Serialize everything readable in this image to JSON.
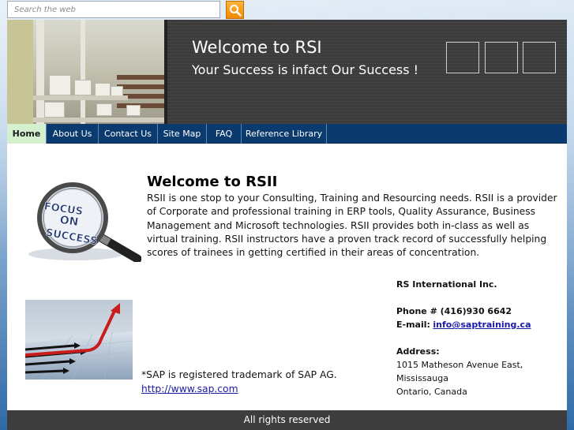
{
  "search": {
    "placeholder": "Search the web"
  },
  "header": {
    "title": "Welcome to RSI",
    "tagline": "Your Success is infact Our Success !"
  },
  "nav": {
    "items": [
      {
        "label": "Home",
        "active": true
      },
      {
        "label": "About Us"
      },
      {
        "label": "Contact Us"
      },
      {
        "label": "Site Map"
      },
      {
        "label": "FAQ"
      },
      {
        "label": "Reference Library"
      }
    ]
  },
  "main": {
    "heading": "Welcome to RSII",
    "intro": "RSII is one stop to your Consulting, Training and Resourcing needs. RSII is a provider of Corporate and professional training in ERP tools, Quality Assurance,  Business Management and Microsoft technologies. RSII provides both in-class as well as virtual training.  RSII instructors have a proven track record of successfully helping scores of trainees in getting certified in their areas of concentration.",
    "intro_link": " ",
    "focus_image": {
      "line1": "FOCUS",
      "line2": "ON",
      "line3": "SUCCESS"
    },
    "sap_note": "*SAP is registered trademark of SAP AG.",
    "sap_link": "http://www.sap.com"
  },
  "contact": {
    "company": "RS International Inc.",
    "phone": "Phone # (416)930 6642",
    "email_label": "E-mail:",
    "email": "info@saptraining.ca",
    "address_label": "Address:",
    "address_line1": "1015 Matheson Avenue East,",
    "address_line2": "Mississauga",
    "address_line3": "Ontario, Canada"
  },
  "footer": {
    "text": "All rights reserved"
  },
  "colors": {
    "nav_bg": "#0b3a6e",
    "nav_active": "#d5f0cf",
    "header_bg": "#3a3a3a",
    "search_button": "#f08a00",
    "link": "#1a1aa6"
  },
  "icons": {
    "search_button": "magnifier-icon"
  }
}
